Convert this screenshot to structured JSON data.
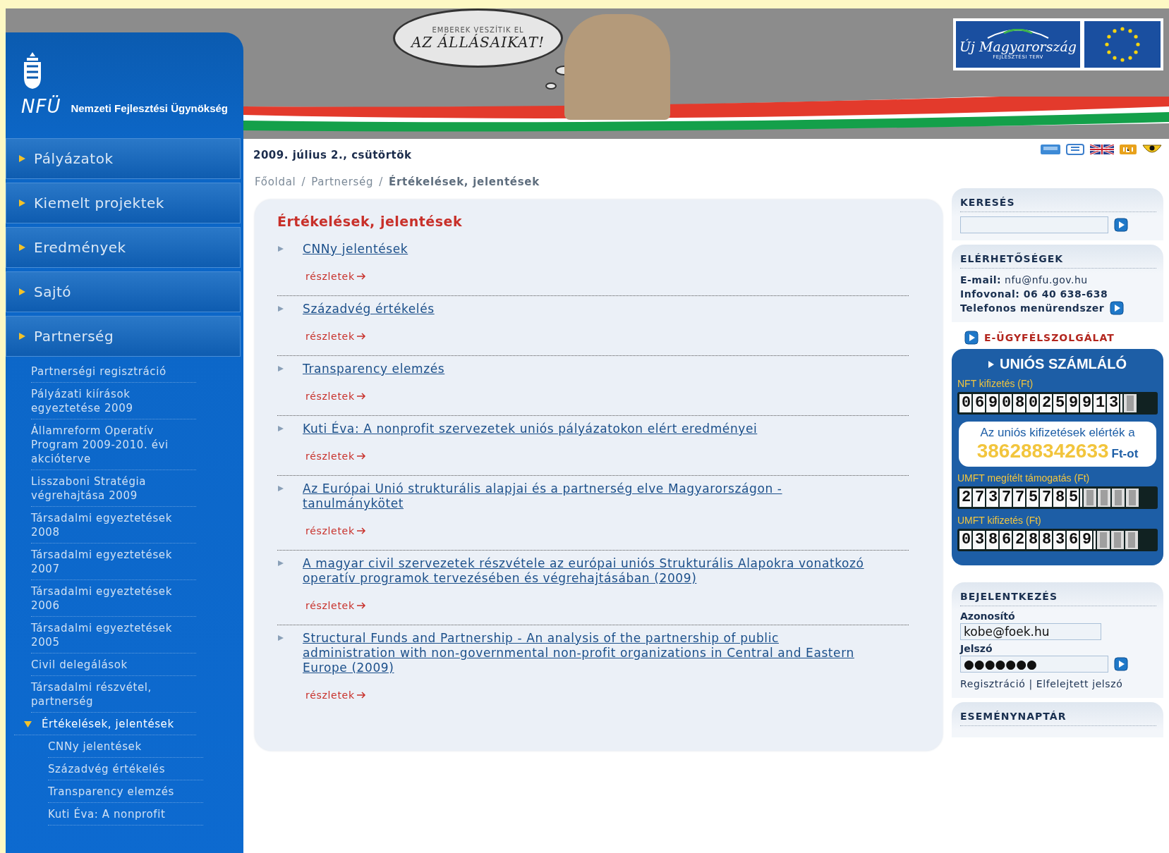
{
  "header": {
    "agency_logo": {
      "mark": "NFÜ",
      "name": "Nemzeti Fejlesztési Ügynökség"
    },
    "banner": {
      "bubble_lines": [
        "EMBEREK VESZÍTIK EL",
        "AZ ÁLLÁSAIKAT!"
      ]
    },
    "program_logo": {
      "name": "Új Magyarország",
      "subtitle": "FEJLESZTÉSI TERV"
    }
  },
  "sidebar": {
    "items": [
      {
        "label": "Pályázatok"
      },
      {
        "label": "Kiemelt projektek"
      },
      {
        "label": "Eredmények"
      },
      {
        "label": "Sajtó"
      },
      {
        "label": "Partnerség",
        "children": [
          {
            "label": "Partnerségi regisztráció",
            "selected": false
          },
          {
            "label": "Pályázati kiírások egyeztetése 2009",
            "selected": false
          },
          {
            "label": "Államreform Operatív Program 2009-2010. évi akcióterve",
            "selected": false
          },
          {
            "label": "Lisszaboni Stratégia végrehajtása 2009",
            "selected": false
          },
          {
            "label": "Társadalmi egyeztetések 2008",
            "selected": false
          },
          {
            "label": "Társadalmi egyeztetések 2007",
            "selected": false
          },
          {
            "label": "Társadalmi egyeztetések 2006",
            "selected": false
          },
          {
            "label": "Társadalmi egyeztetések 2005",
            "selected": false
          },
          {
            "label": "Civil delegálások",
            "selected": false
          },
          {
            "label": "Társadalmi részvétel, partnerség",
            "selected": false
          },
          {
            "label": "Értékelések, jelentések",
            "selected": true,
            "children": [
              {
                "label": "CNNy jelentések",
                "selected": false
              },
              {
                "label": "Századvég értékelés",
                "selected": false
              },
              {
                "label": "Transparency elemzés",
                "selected": false
              },
              {
                "label": "Kuti Éva: A nonprofit",
                "selected": false
              }
            ]
          }
        ]
      }
    ]
  },
  "date": "2009. július 2., csütörtök",
  "breadcrumb": [
    {
      "label": "Főoldal",
      "current": false
    },
    {
      "label": "Partnerség",
      "current": false
    },
    {
      "label": "Értékelések, jelentések",
      "current": true
    }
  ],
  "breadcrumb_separator": "/",
  "content": {
    "title": "Értékelések, jelentések",
    "items": [
      {
        "title": "CNNy jelentések",
        "more": "részletek"
      },
      {
        "title": "Századvég értékelés",
        "more": "részletek"
      },
      {
        "title": "Transparency elemzés",
        "more": "részletek"
      },
      {
        "title": "Kuti Éva: A nonprofit szervezetek uniós pályázatokon elért eredményei",
        "more": "részletek"
      },
      {
        "title": "Az Európai Unió strukturális alapjai és a partnerség elve Magyarországon - tanulmánykötet",
        "more": "részletek"
      },
      {
        "title": "A magyar civil szervezetek részvétele az európai uniós Strukturális Alapokra vonatkozó operatív programok tervezésében és végrehajtásában (2009)",
        "more": "részletek"
      },
      {
        "title": "Structural Funds and Partnership - An analysis of the partnership of public administration with non-governmental non-profit organizations in Central and Eastern Europe (2009)",
        "more": "részletek"
      }
    ]
  },
  "right": {
    "search": {
      "title": "KERESÉS"
    },
    "contacts": {
      "title": "ELÉRHETŐSÉGEK",
      "email_label": "E-mail:",
      "email": "nfu@nfu.gov.hu",
      "hotline": "Infovonal: 06 40 638-638",
      "phone_menu": "Telefonos menürendszer"
    },
    "service_link": "E-ÜGYFÉLSZOLGÁLAT",
    "counter": {
      "title": "UNIÓS SZÁMLÁLÓ",
      "rows": [
        {
          "label": "NFT kifizetés (Ft)",
          "digits": "069080259913"
        },
        {
          "label": "UMFT megítélt támogatás (Ft)",
          "digits": "273775785"
        },
        {
          "label": "UMFT kifizetés (Ft)",
          "digits": "0386288369"
        }
      ],
      "notice": {
        "text": "Az uniós kifizetések elérték a",
        "amount": "386288342633",
        "unit": "Ft-ot"
      }
    },
    "login": {
      "title": "BEJELENTKEZÉS",
      "user_label": "Azonosító",
      "user_value": "kobe@foek.hu",
      "password_label": "Jelszó",
      "password_value": "●●●●●●●",
      "register": "Regisztráció",
      "separator": "|",
      "forgot": "Elfelejtett jelszó"
    },
    "events": {
      "title": "ESEMÉNYNAPTÁR"
    }
  }
}
